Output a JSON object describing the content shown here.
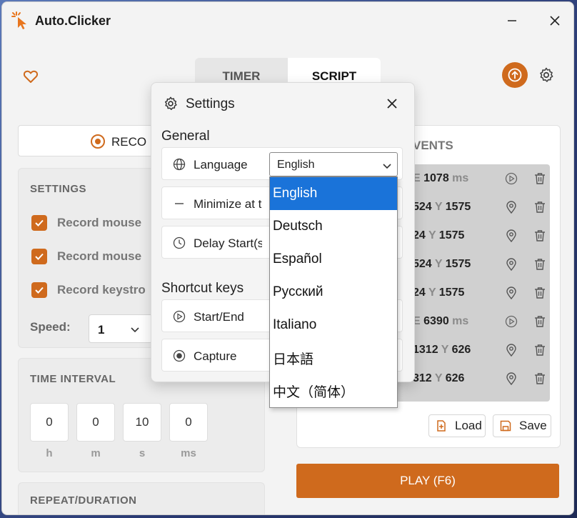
{
  "app": {
    "title": "Auto.Clicker"
  },
  "colors": {
    "accent": "#cf6a1d",
    "selection": "#1a73d9"
  },
  "header": {
    "tabs": [
      {
        "label": "TIMER"
      },
      {
        "label": "SCRIPT"
      }
    ],
    "icons": {
      "favorite": "heart-icon",
      "upgrade": "arrow-up-circle-icon",
      "settings": "gear-icon"
    }
  },
  "record": {
    "label": "RECO"
  },
  "settings_panel": {
    "title": "SETTINGS",
    "options": [
      {
        "label": "Record mouse",
        "checked": true
      },
      {
        "label": "Record mouse",
        "checked": true
      },
      {
        "label": "Record keystro",
        "checked": true
      }
    ],
    "speed_label": "Speed:",
    "speed_value": "1"
  },
  "interval": {
    "title": "TIME INTERVAL",
    "fields": [
      {
        "value": "0",
        "unit": "h"
      },
      {
        "value": "0",
        "unit": "m"
      },
      {
        "value": "10",
        "unit": "s"
      },
      {
        "value": "0",
        "unit": "ms"
      }
    ]
  },
  "repeat": {
    "title": "REPEAT/DURATION"
  },
  "events": {
    "title": "VENTS",
    "rows": [
      {
        "pre": "E",
        "value": "1078",
        "post": "ms",
        "kind": "delay"
      },
      {
        "pre": "",
        "value": "524",
        "post": "Y",
        "value2": "1575",
        "kind": "click"
      },
      {
        "pre": "",
        "value": "24",
        "post": "Y",
        "value2": "1575",
        "kind": "click"
      },
      {
        "pre": "",
        "value": "524",
        "post": "Y",
        "value2": "1575",
        "kind": "click"
      },
      {
        "pre": "",
        "value": "24",
        "post": "Y",
        "value2": "1575",
        "kind": "click"
      },
      {
        "pre": "E",
        "value": "6390",
        "post": "ms",
        "kind": "delay"
      },
      {
        "pre": "",
        "value": "1312",
        "post": "Y",
        "value2": "626",
        "kind": "click"
      },
      {
        "pre": "",
        "value": "312",
        "post": "Y",
        "value2": "626",
        "kind": "click"
      }
    ],
    "load_label": "Load",
    "save_label": "Save"
  },
  "play": {
    "label": "PLAY (F6)"
  },
  "dialog": {
    "title": "Settings",
    "general_title": "General",
    "language_label": "Language",
    "language_value": "English",
    "minimize_label": "Minimize at th",
    "delay_label": "Delay Start(s",
    "shortcut_title": "Shortcut keys",
    "start_end_label": "Start/End",
    "capture_label": "Capture"
  },
  "language_options": [
    {
      "label": "English",
      "selected": true
    },
    {
      "label": "Deutsch"
    },
    {
      "label": "Español"
    },
    {
      "label": "Русский"
    },
    {
      "label": "Italiano"
    },
    {
      "label": "日本語"
    },
    {
      "label": "中文（简体）"
    }
  ]
}
